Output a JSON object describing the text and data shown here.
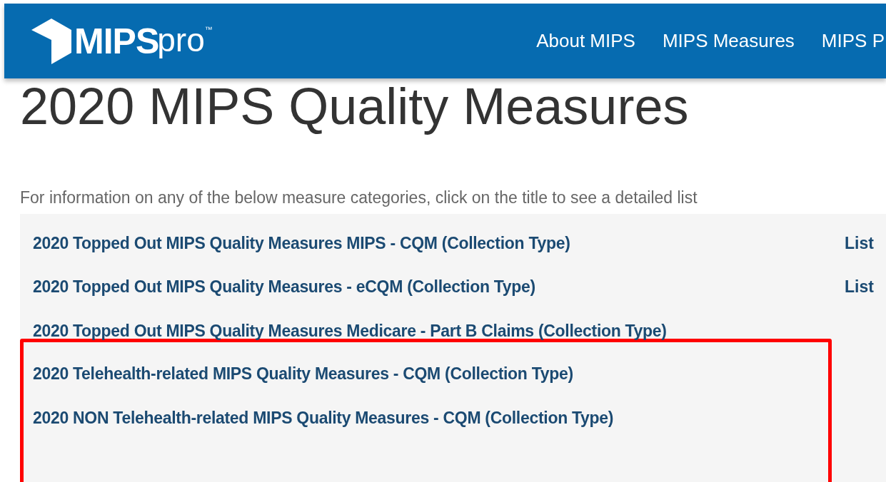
{
  "navbar": {
    "logo": {
      "name": "MIPS",
      "suffix": "pro",
      "mark": "™"
    },
    "links": [
      "About MIPS",
      "MIPS Measures",
      "MIPS P"
    ]
  },
  "heading": "2020 MIPS Quality Measures",
  "intro": "For information on any of the below measure categories, click on the title to see a detailed list",
  "categories": [
    {
      "title": "2020 Topped Out MIPS Quality Measures MIPS - CQM (Collection Type)",
      "side_link": "List",
      "highlighted": false
    },
    {
      "title": "2020 Topped Out MIPS Quality Measures - eCQM (Collection Type)",
      "side_link": "List",
      "highlighted": false
    },
    {
      "title": "2020 Topped Out MIPS Quality Measures Medicare - Part B Claims (Collection Type)",
      "highlighted": false
    },
    {
      "title": "2020 Telehealth-related MIPS Quality Measures - CQM (Collection Type)",
      "highlighted": true
    },
    {
      "title": "2020 NON Telehealth-related MIPS Quality Measures - CQM (Collection Type)",
      "highlighted": true
    }
  ]
}
